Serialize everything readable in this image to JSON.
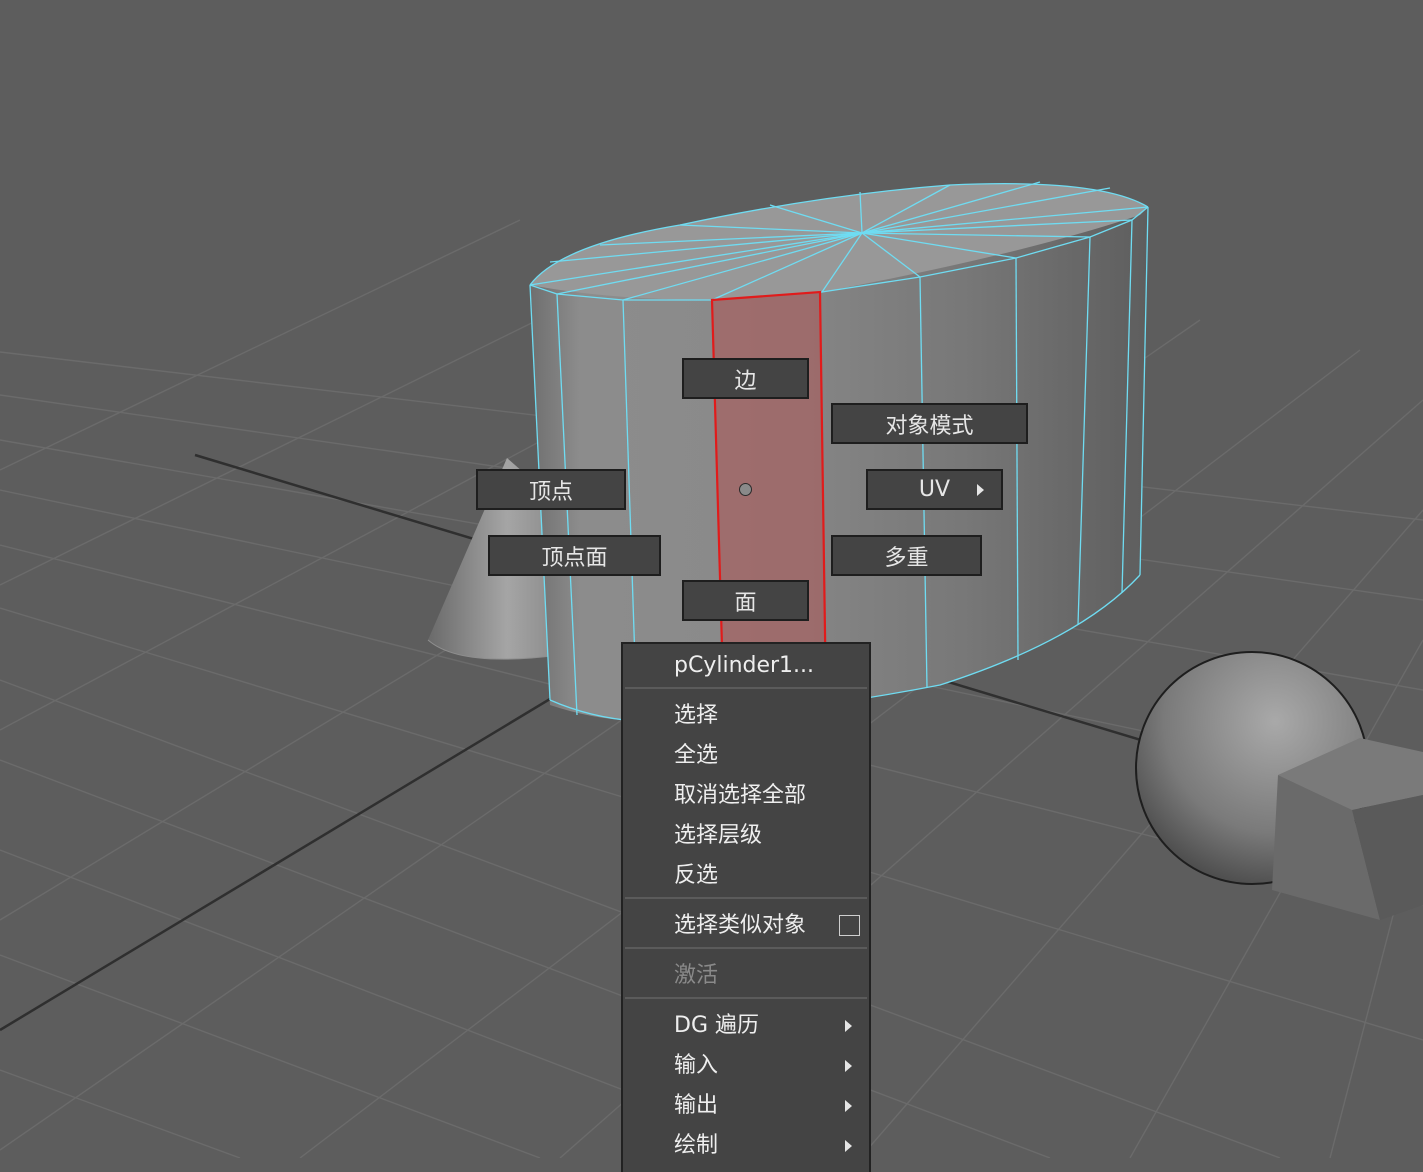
{
  "viewport": {
    "background": "#5d5d5d",
    "highlight_face_color": "#e11b1b",
    "wire_color": "#6fdcf2"
  },
  "marking_menu": {
    "north": "边",
    "northeast": "对象模式",
    "east": "UV",
    "southeast": "多重",
    "south": "面",
    "west": "顶点",
    "southwest": "顶点面"
  },
  "context_menu": {
    "header": "pCylinder1...",
    "items": [
      {
        "label": "选择"
      },
      {
        "label": "全选"
      },
      {
        "label": "取消选择全部"
      },
      {
        "label": "选择层级"
      },
      {
        "label": "反选"
      },
      {
        "label": "选择类似对象"
      },
      {
        "label": "激活"
      },
      {
        "label": "DG 遍历"
      },
      {
        "label": "输入"
      },
      {
        "label": "输出"
      },
      {
        "label": "绘制"
      }
    ]
  }
}
